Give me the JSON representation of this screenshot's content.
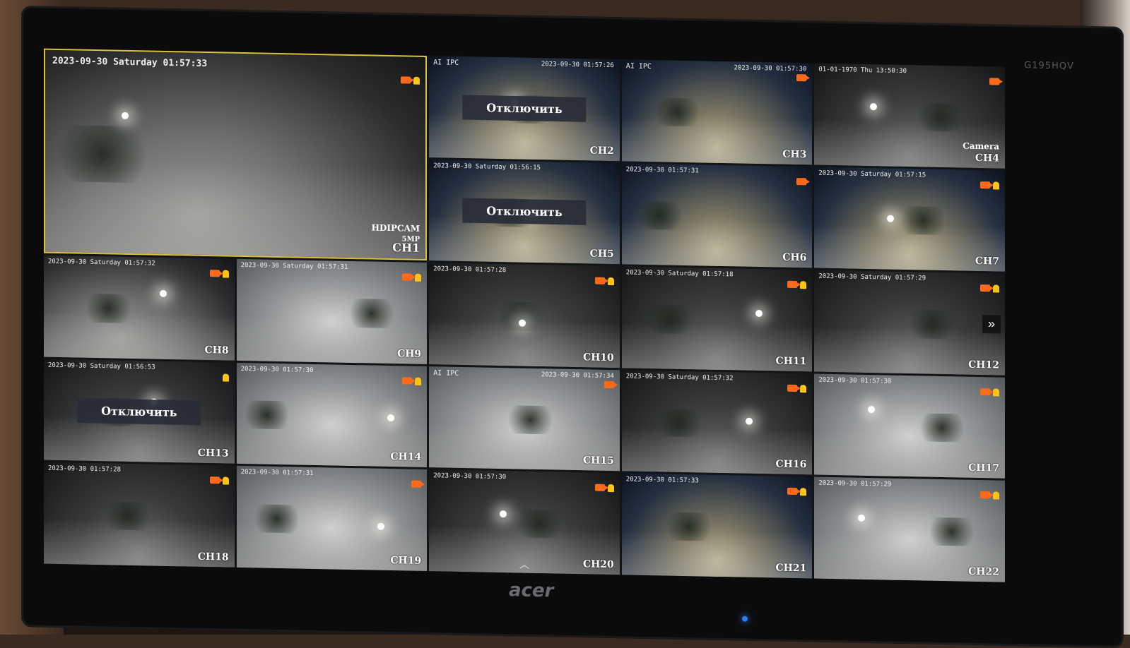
{
  "monitor": {
    "model": "G195HQV",
    "brand": "acer"
  },
  "disable_label": "Отключить",
  "channels": [
    {
      "ch": "CH1",
      "sub": "HDIPCAM",
      "sub2": "5MP",
      "tag": "",
      "time": "2023-09-30 Saturday 01:57:33",
      "rec": true,
      "motion": true
    },
    {
      "ch": "CH2",
      "sub": "",
      "tag": "AI IPC",
      "time": "2023-09-30 01:57:26",
      "rec": false,
      "motion": false,
      "disable": true
    },
    {
      "ch": "CH3",
      "sub": "",
      "tag": "AI IPC",
      "time": "2023-09-30 01:57:30",
      "rec": true,
      "motion": false
    },
    {
      "ch": "CH4",
      "sub": "Camera",
      "tag": "",
      "time": "01-01-1970 Thu 13:50:30",
      "rec": true,
      "motion": false
    },
    {
      "ch": "CH5",
      "sub": "",
      "tag": "",
      "time": "2023-09-30 Saturday 01:56:15",
      "rec": false,
      "motion": false,
      "disable": true
    },
    {
      "ch": "CH6",
      "sub": "",
      "tag": "",
      "time": "2023-09-30 01:57:31",
      "rec": true,
      "motion": false
    },
    {
      "ch": "CH7",
      "sub": "",
      "tag": "",
      "time": "2023-09-30 Saturday 01:57:15",
      "rec": true,
      "motion": true
    },
    {
      "ch": "CH8",
      "sub": "",
      "tag": "",
      "time": "2023-09-30 Saturday 01:57:32",
      "rec": true,
      "motion": true
    },
    {
      "ch": "CH9",
      "sub": "",
      "tag": "",
      "time": "2023-09-30 Saturday 01:57:31",
      "rec": true,
      "motion": true
    },
    {
      "ch": "CH10",
      "sub": "",
      "tag": "",
      "time": "2023-09-30 01:57:28",
      "rec": true,
      "motion": true
    },
    {
      "ch": "CH11",
      "sub": "",
      "tag": "",
      "time": "2023-09-30 Saturday 01:57:18",
      "rec": true,
      "motion": true
    },
    {
      "ch": "CH12",
      "sub": "",
      "tag": "",
      "time": "2023-09-30 Saturday 01:57:29",
      "rec": true,
      "motion": true,
      "next": true
    },
    {
      "ch": "CH13",
      "sub": "",
      "tag": "",
      "time": "2023-09-30 Saturday 01:56:53",
      "rec": false,
      "motion": true,
      "disable": true
    },
    {
      "ch": "CH14",
      "sub": "",
      "tag": "",
      "time": "2023-09-30 01:57:30",
      "rec": true,
      "motion": true
    },
    {
      "ch": "CH15",
      "sub": "",
      "tag": "AI IPC",
      "time": "2023-09-30 01:57:34",
      "rec": true,
      "motion": false
    },
    {
      "ch": "CH16",
      "sub": "",
      "tag": "",
      "time": "2023-09-30 Saturday 01:57:32",
      "rec": true,
      "motion": true
    },
    {
      "ch": "CH17",
      "sub": "",
      "tag": "",
      "time": "2023-09-30 01:57:30",
      "rec": true,
      "motion": true
    },
    {
      "ch": "CH18",
      "sub": "",
      "tag": "",
      "time": "2023-09-30 01:57:28",
      "rec": true,
      "motion": true
    },
    {
      "ch": "CH19",
      "sub": "",
      "tag": "",
      "time": "2023-09-30 01:57:31",
      "rec": true,
      "motion": false
    },
    {
      "ch": "CH20",
      "sub": "",
      "tag": "",
      "time": "2023-09-30 01:57:30",
      "rec": true,
      "motion": true,
      "up": true
    },
    {
      "ch": "CH21",
      "sub": "",
      "tag": "",
      "time": "2023-09-30 01:57:33",
      "rec": true,
      "motion": true
    },
    {
      "ch": "CH22",
      "sub": "",
      "tag": "",
      "time": "2023-09-30 01:57:29",
      "rec": true,
      "motion": true
    }
  ],
  "icons": {
    "rec": "record-icon",
    "motion": "motion-alarm-icon",
    "next": "chevron-double-right-icon",
    "up": "chevron-up-icon"
  },
  "colors": {
    "rec": "#ff6a1a",
    "motion": "#ffc414",
    "selected_border": "#d9c23a",
    "led": "#2f7bff"
  }
}
